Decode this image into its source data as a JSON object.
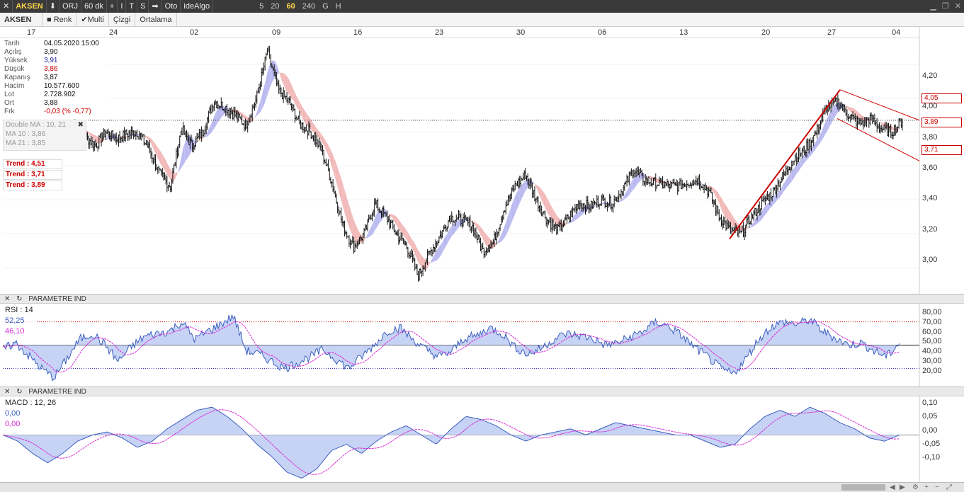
{
  "toolbar": {
    "symbol": "AKSEN",
    "mode": "ORJ",
    "period": "60 dk",
    "btn_plus": "+",
    "btn_i": "I",
    "btn_t": "T",
    "btn_s": "S",
    "auto": "Oto",
    "algo": "ideAlgo",
    "periods": [
      "5",
      "20",
      "60",
      "240",
      "G",
      "H"
    ],
    "active_period": "60"
  },
  "tabs": {
    "symbol": "AKSEN",
    "renk": "Renk",
    "multi": "Multi",
    "cizgi": "Çizgi",
    "ortalama": "Ortalama"
  },
  "dates": [
    "17",
    "24",
    "02",
    "09",
    "16",
    "23",
    "30",
    "06",
    "13",
    "20",
    "27",
    "04"
  ],
  "info": [
    {
      "k": "Tarih",
      "v": "04.05.2020 15:00",
      "c": "#111111"
    },
    {
      "k": "Açılış",
      "v": "3,90",
      "c": "#111111"
    },
    {
      "k": "Yüksek",
      "v": "3,91",
      "c": "#1a1aa8"
    },
    {
      "k": "Düşük",
      "v": "3,86",
      "c": "#cc0000"
    },
    {
      "k": "Kapanış",
      "v": "3,87",
      "c": "#111111"
    },
    {
      "k": "Hacim",
      "v": "10.577.600",
      "c": "#111111"
    },
    {
      "k": "Lot",
      "v": "2.728.902",
      "c": "#111111"
    },
    {
      "k": "Ort",
      "v": "3,88",
      "c": "#111111"
    },
    {
      "k": "Frk",
      "v": "-0,03 (% -0,77)",
      "c": "#cc0000"
    }
  ],
  "ma": {
    "title": "Double MA :  10,  21",
    "ma10": "MA 10 : 3,86",
    "ma21": "MA 21 : 3,85"
  },
  "trends": [
    "Trend  :  4,51",
    "Trend  :  3,71",
    "Trend  :  3,89"
  ],
  "price_boxes": [
    "4,05",
    "3,89",
    "3,71"
  ],
  "price_axis": [
    "4,20",
    "4,00",
    "3,80",
    "3,60",
    "3,40",
    "3,20",
    "3,00"
  ],
  "rsi_panel": {
    "label": "PARAMETRE    IND",
    "title": "RSI :  14",
    "v1": "52,25",
    "v2": "46,10"
  },
  "rsi_axis": [
    "80,00",
    "70,00",
    "60,00",
    "50,00",
    "40,00",
    "30,00",
    "20,00"
  ],
  "macd_panel": {
    "label": "PARAMETRE    IND",
    "title": "MACD :  12,  26",
    "v1": "0,00",
    "v2": "0,00"
  },
  "macd_axis": [
    "0,10",
    "0,05",
    "0,00",
    "-0,05",
    "-0,10"
  ],
  "colors": {
    "up_ma": "#b9b9f0",
    "down_ma": "#f2b8b8",
    "trend": "#cc0000",
    "rsi": "#3b5fc0",
    "signal": "#d62ad6"
  },
  "chart_data": [
    {
      "type": "candlestick",
      "title": "AKSEN 60 dk",
      "x": [
        "17",
        "24",
        "02",
        "09",
        "16",
        "23",
        "30",
        "06",
        "13",
        "20",
        "27",
        "04"
      ],
      "close_path": [
        3.86,
        3.78,
        3.72,
        3.8,
        3.76,
        3.79,
        3.8,
        3.7,
        3.55,
        3.48,
        3.82,
        3.72,
        3.8,
        3.98,
        3.95,
        3.9,
        3.84,
        4.0,
        4.28,
        4.05,
        3.98,
        3.85,
        3.8,
        3.7,
        3.5,
        3.25,
        3.12,
        3.2,
        3.38,
        3.3,
        3.2,
        3.12,
        2.95,
        3.08,
        3.18,
        3.3,
        3.28,
        3.25,
        3.1,
        3.15,
        3.35,
        3.48,
        3.55,
        3.4,
        3.28,
        3.22,
        3.3,
        3.38,
        3.36,
        3.4,
        3.38,
        3.46,
        3.58,
        3.52,
        3.5,
        3.49,
        3.48,
        3.5,
        3.52,
        3.45,
        3.3,
        3.22,
        3.2,
        3.3,
        3.38,
        3.45,
        3.55,
        3.65,
        3.7,
        3.8,
        3.95,
        3.98,
        3.9,
        3.85,
        3.88,
        3.82,
        3.8,
        3.87
      ],
      "ylim": [
        2.85,
        4.35
      ]
    },
    {
      "type": "line",
      "title": "RSI 14",
      "series": [
        {
          "name": "RSI",
          "values": [
            46,
            52,
            41,
            30,
            22,
            38,
            55,
            60,
            50,
            36,
            48,
            57,
            60,
            62,
            70,
            55,
            62,
            68,
            75,
            45,
            42,
            36,
            30,
            35,
            40,
            46,
            38,
            30,
            40,
            50,
            62,
            65,
            55,
            46,
            40,
            44,
            56,
            58,
            65,
            60,
            48,
            42,
            47,
            55,
            60,
            58,
            56,
            50,
            52,
            57,
            62,
            70,
            66,
            58,
            48,
            40,
            30,
            25,
            38,
            55,
            66,
            70,
            68,
            72,
            62,
            56,
            50,
            52,
            45,
            40,
            52
          ]
        }
      ],
      "ylim": [
        15,
        85
      ]
    },
    {
      "type": "line",
      "title": "MACD 12, 26",
      "series": [
        {
          "name": "MACD",
          "values": [
            0.0,
            -0.02,
            -0.06,
            -0.09,
            -0.06,
            -0.02,
            0.0,
            0.01,
            -0.01,
            -0.04,
            -0.02,
            0.02,
            0.05,
            0.08,
            0.09,
            0.06,
            0.02,
            -0.03,
            -0.07,
            -0.12,
            -0.14,
            -0.11,
            -0.05,
            -0.03,
            -0.06,
            -0.02,
            0.01,
            0.03,
            0.0,
            -0.03,
            0.02,
            0.06,
            0.05,
            0.03,
            0.0,
            -0.02,
            0.0,
            0.01,
            0.02,
            0.0,
            0.02,
            0.04,
            0.03,
            0.02,
            0.01,
            0.0,
            0.0,
            -0.02,
            -0.04,
            -0.03,
            0.02,
            0.06,
            0.08,
            0.06,
            0.09,
            0.07,
            0.04,
            0.02,
            -0.01,
            -0.02,
            0.0
          ]
        }
      ],
      "ylim": [
        -0.15,
        0.12
      ]
    }
  ]
}
